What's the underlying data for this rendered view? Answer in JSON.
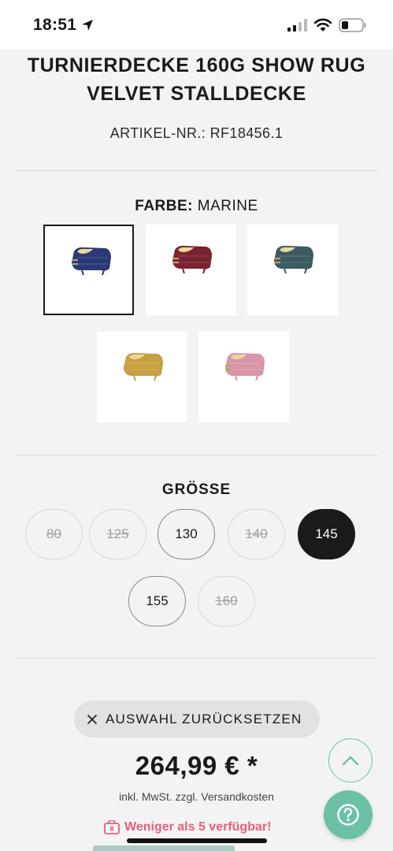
{
  "status_bar": {
    "time": "18:51"
  },
  "product": {
    "title_line1": "TURNIERDECKE 160G SHOW RUG",
    "title_line2": "VELVET STALLDECKE",
    "sku": "ARTIKEL-NR.: RF18456.1"
  },
  "color": {
    "label": "FARBE:",
    "selected": "MARINE",
    "swatches": [
      {
        "name": "marine",
        "hex": "#2a3a78",
        "selected": true
      },
      {
        "name": "bordeaux",
        "hex": "#7a2230",
        "selected": false
      },
      {
        "name": "petrol",
        "hex": "#3b5a62",
        "selected": false
      },
      {
        "name": "mustard",
        "hex": "#c9a040",
        "selected": false
      },
      {
        "name": "rose",
        "hex": "#d996a8",
        "selected": false
      }
    ]
  },
  "size": {
    "title": "GRÖSSE",
    "options": [
      {
        "label": "80",
        "state": "unavailable"
      },
      {
        "label": "125",
        "state": "unavailable"
      },
      {
        "label": "130",
        "state": "available"
      },
      {
        "label": "140",
        "state": "unavailable"
      },
      {
        "label": "145",
        "state": "selected"
      },
      {
        "label": "155",
        "state": "available"
      },
      {
        "label": "160",
        "state": "unavailable"
      }
    ]
  },
  "reset": {
    "label": "AUSWAHL ZURÜCKSETZEN"
  },
  "price": {
    "value": "264,99 € *",
    "tax_note": "inkl. MwSt. zzgl. Versandkosten"
  },
  "stock": {
    "text": "Weniger als 5 verfügbar!"
  },
  "colors": {
    "accent": "#6cc0a6",
    "alert": "#e2627a",
    "dark": "#1a1a1a"
  }
}
